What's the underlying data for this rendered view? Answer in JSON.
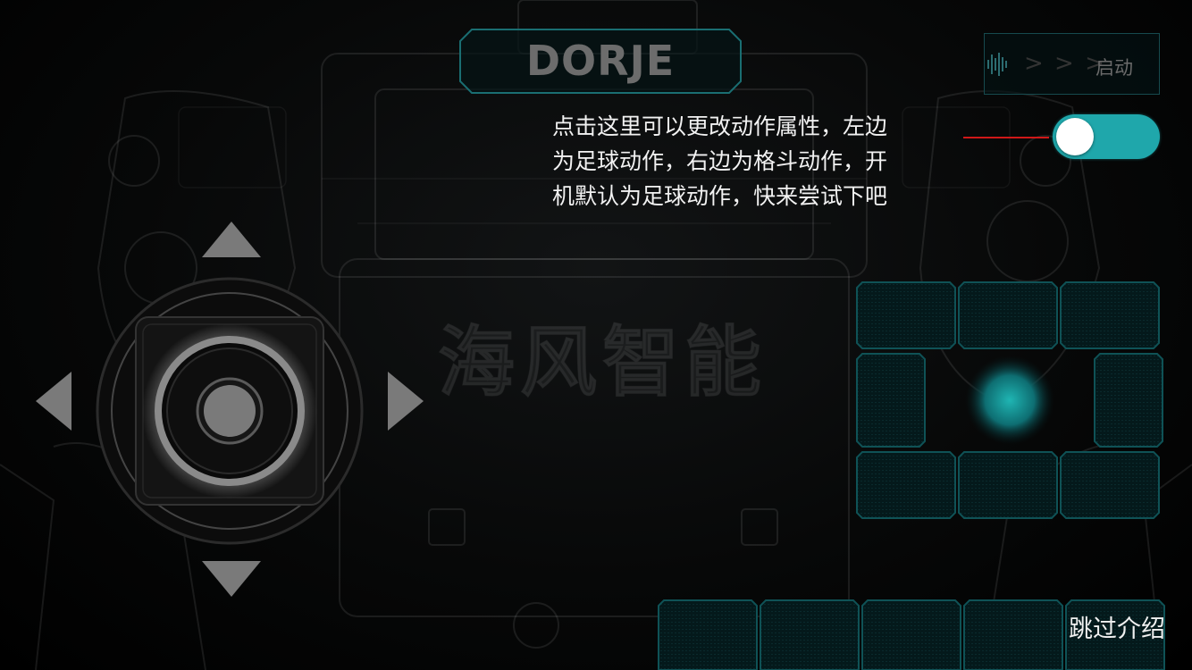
{
  "app": {
    "title": "DORJE",
    "watermark": "海风智能"
  },
  "start_button": {
    "chevrons": "> > >",
    "label": "启动"
  },
  "tooltip": {
    "lines": [
      "点击这里可以更改动作属性，左边",
      "为足球动作，右边为格斗动作，开",
      "机默认为足球动作，快来尝试下吧"
    ]
  },
  "mode_toggle": {
    "state": "off",
    "color": "#1fa7ab"
  },
  "joystick": {
    "icons": [
      "arrow-up-icon",
      "arrow-down-icon",
      "arrow-left-icon",
      "arrow-right-icon"
    ]
  },
  "skip": {
    "label": "跳过介绍"
  },
  "colors": {
    "accent": "#1fa7ab",
    "pad_cyan": "#0e6e72",
    "tooltip_line": "#d01818"
  }
}
